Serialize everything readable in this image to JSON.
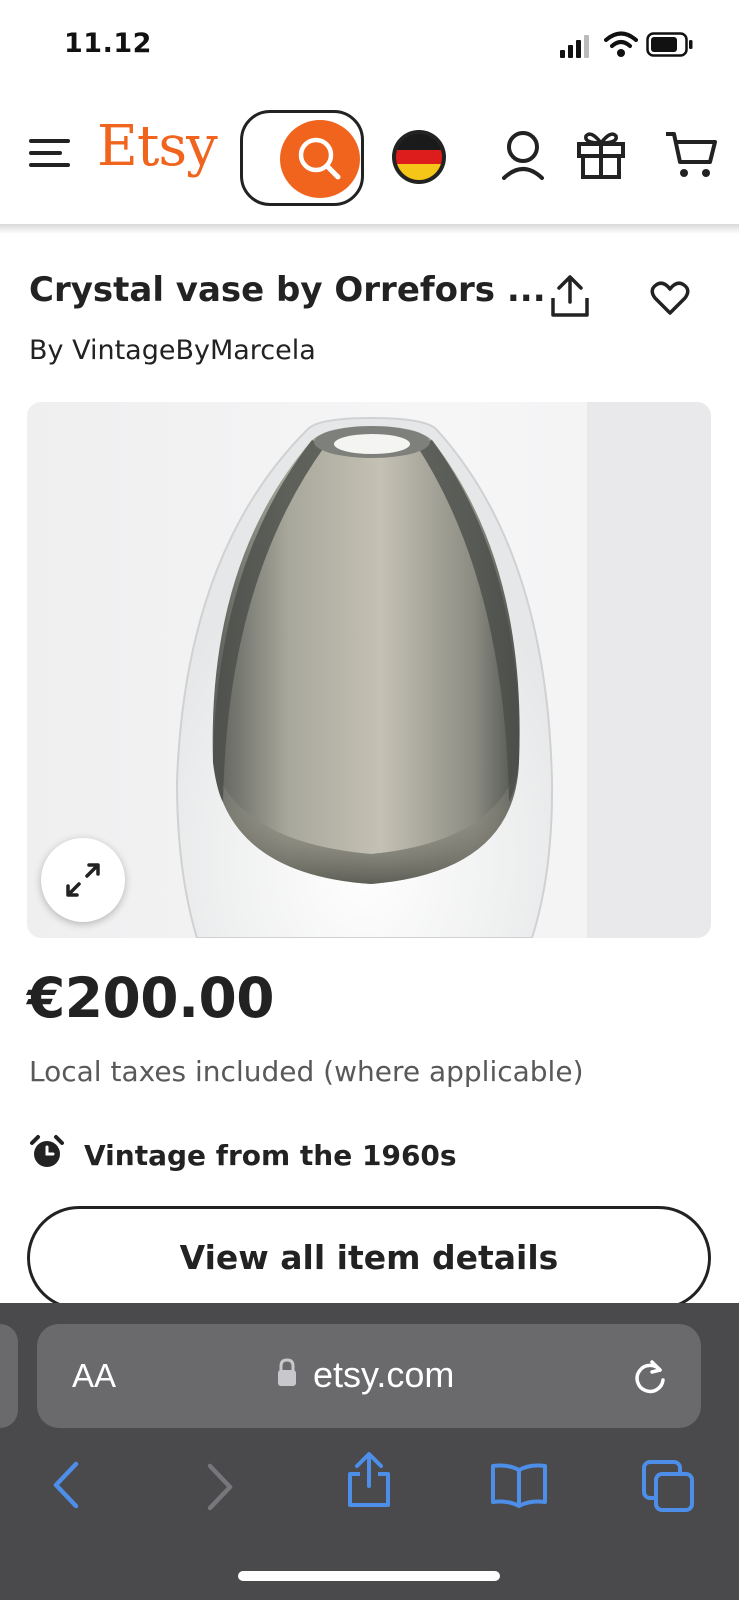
{
  "status_bar": {
    "time": "11.12"
  },
  "header": {
    "logo": "Etsy"
  },
  "listing": {
    "title": "Crystal vase by Orrefors ...",
    "byline": "By VintageByMarcela",
    "price": "€200.00",
    "tax_note": "Local taxes included (where applicable)",
    "vintage_note": "Vintage from the 1960s",
    "details_button": "View all item details"
  },
  "browser": {
    "text_size_button": "AA",
    "domain": "etsy.com"
  },
  "colors": {
    "brand": "#F1641E",
    "toolbar": "#4a4a4c",
    "toolbar_accent": "#4c8ee8"
  },
  "icons": [
    "signal-icon",
    "wifi-icon",
    "battery-icon",
    "menu-icon",
    "search-icon",
    "germany-flag-icon",
    "account-icon",
    "gift-icon",
    "cart-icon",
    "share-icon",
    "heart-icon",
    "expand-icon",
    "alarm-clock-icon",
    "lock-icon",
    "reload-icon",
    "back-icon",
    "forward-icon",
    "share-icon",
    "bookmarks-icon",
    "tabs-icon"
  ]
}
